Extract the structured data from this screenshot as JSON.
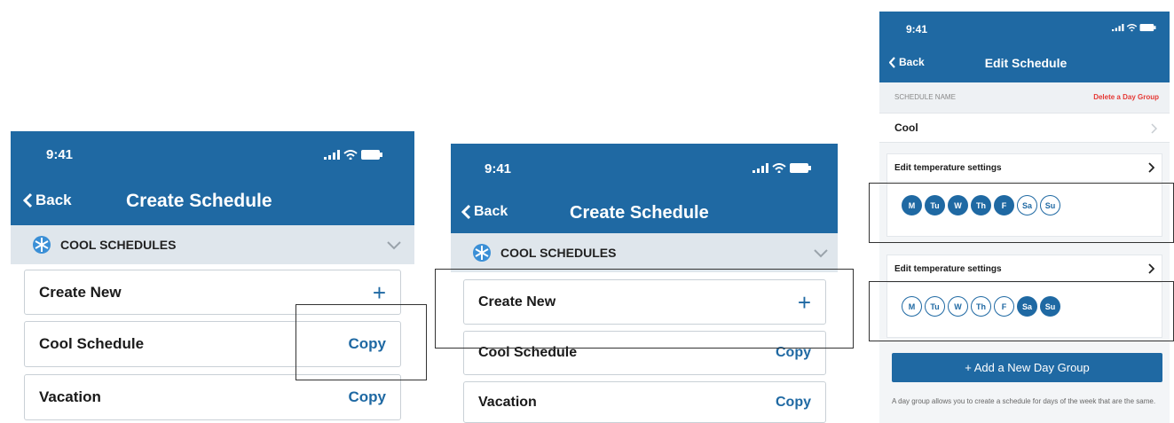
{
  "panel1": {
    "time": "9:41",
    "back_label": "Back",
    "title": "Create Schedule",
    "section_label": "COOL SCHEDULES",
    "items": [
      {
        "label": "Create New"
      },
      {
        "label": "Cool Schedule",
        "action": "Copy"
      },
      {
        "label": "Vacation",
        "action": "Copy"
      }
    ]
  },
  "panel2": {
    "time": "9:41",
    "back_label": "Back",
    "title": "Create Schedule",
    "section_label": "COOL SCHEDULES",
    "items": [
      {
        "label": "Create New"
      },
      {
        "label": "Cool Schedule",
        "action": "Copy"
      },
      {
        "label": "Vacation",
        "action": "Copy"
      }
    ]
  },
  "panel3": {
    "time": "9:41",
    "back_label": "Back",
    "title": "Edit Schedule",
    "schedule_name_label": "SCHEDULE NAME",
    "delete_label": "Delete a Day Group",
    "schedule_name_value": "Cool",
    "groups": [
      {
        "label": "Edit temperature settings",
        "days": [
          {
            "d": "M",
            "on": true
          },
          {
            "d": "Tu",
            "on": true
          },
          {
            "d": "W",
            "on": true
          },
          {
            "d": "Th",
            "on": true
          },
          {
            "d": "F",
            "on": true
          },
          {
            "d": "Sa",
            "on": false
          },
          {
            "d": "Su",
            "on": false
          }
        ]
      },
      {
        "label": "Edit temperature settings",
        "days": [
          {
            "d": "M",
            "on": false
          },
          {
            "d": "Tu",
            "on": false
          },
          {
            "d": "W",
            "on": false
          },
          {
            "d": "Th",
            "on": false
          },
          {
            "d": "F",
            "on": false
          },
          {
            "d": "Sa",
            "on": true
          },
          {
            "d": "Su",
            "on": true
          }
        ]
      }
    ],
    "add_button": "+ Add a New Day Group",
    "footnote": "A day group allows you to create a schedule for days of the week that are the same."
  },
  "colors": {
    "brand": "#1f69a3",
    "section_bg": "#dfe6ec",
    "delete": "#e53935"
  }
}
